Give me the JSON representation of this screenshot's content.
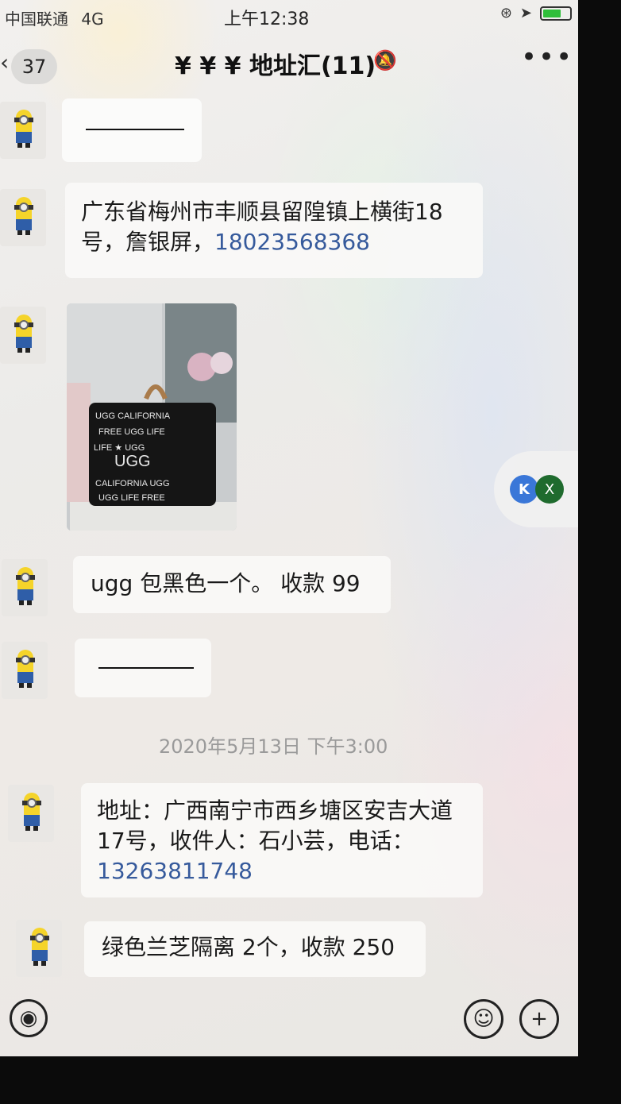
{
  "status_bar": {
    "carrier": "中国联通",
    "network": "4G",
    "time": "上午12:38"
  },
  "nav": {
    "unread_count": "37",
    "title": "¥ ¥ ¥ 地址汇(11)"
  },
  "messages": [
    {
      "type": "dash"
    },
    {
      "type": "text",
      "text": "广东省梅州市丰顺县留隍镇上横街18号，詹银屏，",
      "phone": "18023568368"
    },
    {
      "type": "image",
      "image_desc": "bag-photo"
    },
    {
      "type": "text",
      "text": "ugg 包黑色一个。 收款 99"
    },
    {
      "type": "dash"
    },
    {
      "type": "timestamp",
      "text": "2020年5月13日 下午3:00"
    },
    {
      "type": "text",
      "text": "地址：广西南宁市西乡塘区安吉大道17号，收件人：石小芸，电话：",
      "phone": "13263811748"
    },
    {
      "type": "text",
      "text": "绿色兰芝隔离 2个，收款 250"
    }
  ],
  "floating_widget": {
    "badge_a": "K",
    "badge_b": "X"
  },
  "colors": {
    "link": "#365a9c",
    "battery": "#2fbf3a"
  }
}
